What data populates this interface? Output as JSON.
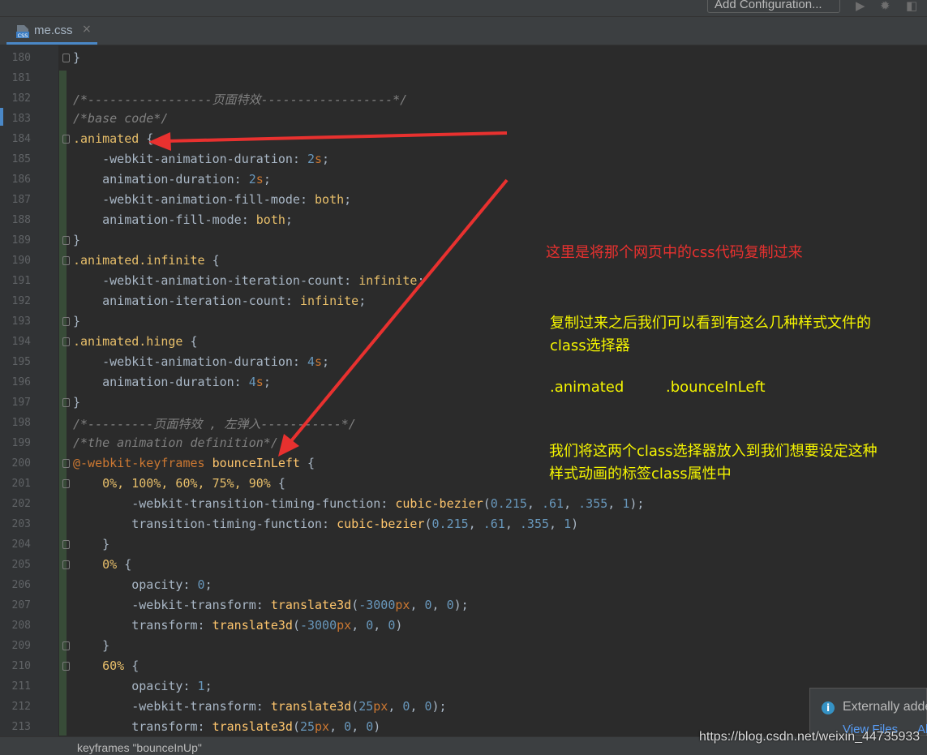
{
  "toolbar": {
    "add_configuration": "Add Configuration...",
    "icons": [
      "run-icon",
      "debug-icon",
      "coverage-icon"
    ]
  },
  "tab": {
    "icon_text": "CSS",
    "label": "me.css",
    "close": "×"
  },
  "code_lines": [
    {
      "n": "180",
      "fold": true,
      "html": "}"
    },
    {
      "n": "181",
      "fold": false,
      "html": ""
    },
    {
      "n": "182",
      "fold": false,
      "html": "<span class='cm'>/*-----------------页面特效------------------*/</span>"
    },
    {
      "n": "183",
      "fold": false,
      "html": "<span class='cm'>/*base code*/</span>"
    },
    {
      "n": "184",
      "fold": true,
      "html": "<span class='sel'>.animated</span> {"
    },
    {
      "n": "185",
      "fold": false,
      "html": "    -webkit-animation-duration: <span class='num'>2</span><span class='kw'>s</span>;"
    },
    {
      "n": "186",
      "fold": false,
      "html": "    animation-duration: <span class='num'>2</span><span class='kw'>s</span>;"
    },
    {
      "n": "187",
      "fold": false,
      "html": "    -webkit-animation-fill-mode: <span class='pct'>both</span>;"
    },
    {
      "n": "188",
      "fold": false,
      "html": "    animation-fill-mode: <span class='pct'>both</span>;"
    },
    {
      "n": "189",
      "fold": true,
      "html": "}"
    },
    {
      "n": "190",
      "fold": true,
      "html": "<span class='sel'>.animated.infinite</span> {"
    },
    {
      "n": "191",
      "fold": false,
      "html": "    -webkit-animation-iteration-count: <span class='pct'>infinite</span>;"
    },
    {
      "n": "192",
      "fold": false,
      "html": "    animation-iteration-count: <span class='pct'>infinite</span>;"
    },
    {
      "n": "193",
      "fold": true,
      "html": "}"
    },
    {
      "n": "194",
      "fold": true,
      "html": "<span class='sel'>.animated.hinge</span> {"
    },
    {
      "n": "195",
      "fold": false,
      "html": "    -webkit-animation-duration: <span class='num'>4</span><span class='kw'>s</span>;"
    },
    {
      "n": "196",
      "fold": false,
      "html": "    animation-duration: <span class='num'>4</span><span class='kw'>s</span>;"
    },
    {
      "n": "197",
      "fold": true,
      "html": "}"
    },
    {
      "n": "198",
      "fold": false,
      "html": "<span class='cm'>/*---------页面特效 , 左弹入-----------*/</span>"
    },
    {
      "n": "199",
      "fold": false,
      "html": "<span class='cm'>/*the animation definition*/</span>"
    },
    {
      "n": "200",
      "fold": true,
      "html": "<span class='at'>@-webkit-keyframes</span> <span class='name'>bounceInLeft</span> {"
    },
    {
      "n": "201",
      "fold": true,
      "html": "    <span class='pct'>0%, 100%, 60%, 75%, 90%</span> {"
    },
    {
      "n": "202",
      "fold": false,
      "html": "        -webkit-transition-timing-function: <span class='val'>cubic-bezier</span>(<span class='num'>0.215</span>, <span class='num'>.61</span>, <span class='num'>.355</span>, <span class='num'>1</span>);"
    },
    {
      "n": "203",
      "fold": false,
      "html": "        transition-timing-function: <span class='val'>cubic-bezier</span>(<span class='num'>0.215</span>, <span class='num'>.61</span>, <span class='num'>.355</span>, <span class='num'>1</span>)"
    },
    {
      "n": "204",
      "fold": true,
      "html": "    }"
    },
    {
      "n": "205",
      "fold": true,
      "html": "    <span class='pct'>0%</span> {"
    },
    {
      "n": "206",
      "fold": false,
      "html": "        opacity: <span class='num'>0</span>;"
    },
    {
      "n": "207",
      "fold": false,
      "html": "        -webkit-transform: <span class='val'>translate3d</span>(<span class='num'>-3000</span><span class='kw'>px</span>, <span class='num'>0</span>, <span class='num'>0</span>);"
    },
    {
      "n": "208",
      "fold": false,
      "html": "        transform: <span class='val'>translate3d</span>(<span class='num'>-3000</span><span class='kw'>px</span>, <span class='num'>0</span>, <span class='num'>0</span>)"
    },
    {
      "n": "209",
      "fold": true,
      "html": "    }"
    },
    {
      "n": "210",
      "fold": true,
      "html": "    <span class='pct'>60%</span> {"
    },
    {
      "n": "211",
      "fold": false,
      "html": "        opacity: <span class='num'>1</span>;"
    },
    {
      "n": "212",
      "fold": false,
      "html": "        -webkit-transform: <span class='val'>translate3d</span>(<span class='num'>25</span><span class='kw'>px</span>, <span class='num'>0</span>, <span class='num'>0</span>);"
    },
    {
      "n": "213",
      "fold": false,
      "html": "        transform: <span class='val'>translate3d</span>(<span class='num'>25</span><span class='kw'>px</span>, <span class='num'>0</span>, <span class='num'>0</span>)"
    }
  ],
  "annotations": {
    "red_note": "这里是将那个网页中的css代码复制过来",
    "yellow_1_line1": "复制过来之后我们可以看到有这么几种样式文件的",
    "yellow_1_line2": "class选择器",
    "class_a": ".animated",
    "class_b": ".bounceInLeft",
    "yellow_2_line1": "我们将这两个class选择器放入到我们想要设定这种",
    "yellow_2_line2": "样式动画的标签class属性中",
    "red_color": "#e8312f",
    "yellow_color": "#f5f500"
  },
  "notification": {
    "icon": "i",
    "text": "Externally added",
    "link1": "View Files",
    "link2": "Al"
  },
  "statusbar": {
    "breadcrumb": "keyframes \"bounceInUp\""
  },
  "watermark": "https://blog.csdn.net/weixin_44735933"
}
